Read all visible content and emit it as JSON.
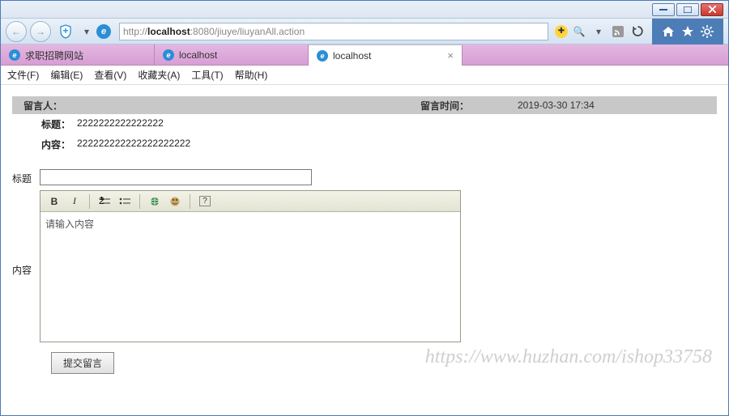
{
  "window": {
    "url_pre": "http://",
    "url_bold": "localhost",
    "url_post": ":8080/jiuye/liuyanAll.action"
  },
  "tabs": [
    {
      "label": "求职招聘网站"
    },
    {
      "label": "localhost"
    },
    {
      "label": "localhost"
    }
  ],
  "menus": {
    "file": "文件(F)",
    "edit": "编辑(E)",
    "view": "查看(V)",
    "fav": "收藏夹(A)",
    "tools": "工具(T)",
    "help": "帮助(H)"
  },
  "message": {
    "author_label": "留言人：",
    "author_value": "",
    "time_label": "留言时间：",
    "time_value": "2019-03-30 17:34",
    "title_label": "标题：",
    "title_value": "2222222222222222",
    "content_label": "内容：",
    "content_value": "222222222222222222222"
  },
  "form": {
    "title_label": "标题",
    "content_label": "内容",
    "placeholder": "请输入内容",
    "submit": "提交留言"
  },
  "watermark": "https://www.huzhan.com/ishop33758"
}
